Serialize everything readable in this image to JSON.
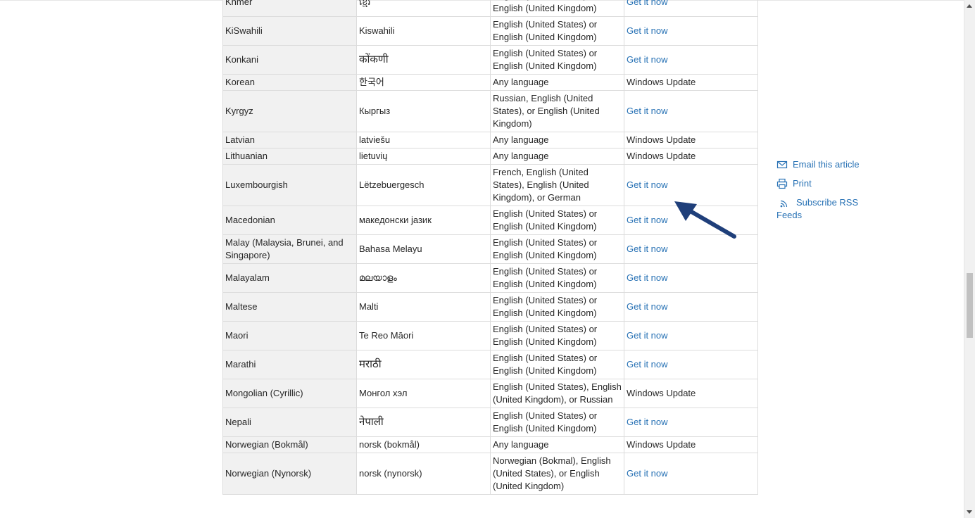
{
  "rows": [
    {
      "language": "Khmer",
      "native": "ខ្មែរ",
      "base": "English (United States) or English (United Kingdom)",
      "get": "Get it now",
      "link": true,
      "large": false
    },
    {
      "language": "KiSwahili",
      "native": "Kiswahili",
      "base": "English (United States) or English (United Kingdom)",
      "get": "Get it now",
      "link": true,
      "large": false
    },
    {
      "language": "Konkani",
      "native": "कोंकणी",
      "base": "English (United States) or English (United Kingdom)",
      "get": "Get it now",
      "link": true,
      "large": true
    },
    {
      "language": "Korean",
      "native": "한국어",
      "base": "Any language",
      "get": "Windows Update",
      "link": false,
      "large": false
    },
    {
      "language": "Kyrgyz",
      "native": "Кыргыз",
      "base": "Russian, English (United States), or English (United Kingdom)",
      "get": "Get it now",
      "link": true,
      "large": false
    },
    {
      "language": "Latvian",
      "native": "latviešu",
      "base": "Any language",
      "get": "Windows Update",
      "link": false,
      "large": false
    },
    {
      "language": "Lithuanian",
      "native": "lietuvių",
      "base": "Any language",
      "get": "Windows Update",
      "link": false,
      "large": false
    },
    {
      "language": "Luxembourgish",
      "native": "Lëtzebuergesch",
      "base": "French, English (United States), English (United Kingdom), or German",
      "get": "Get it now",
      "link": true,
      "large": false
    },
    {
      "language": "Macedonian",
      "native": "македонски јазик",
      "base": "English (United States) or English (United Kingdom)",
      "get": "Get it now",
      "link": true,
      "large": false
    },
    {
      "language": "Malay (Malaysia, Brunei, and Singapore)",
      "native": "Bahasa Melayu",
      "base": "English (United States) or English (United Kingdom)",
      "get": "Get it now",
      "link": true,
      "large": false
    },
    {
      "language": "Malayalam",
      "native": "മലയാളം",
      "base": "English (United States) or English (United Kingdom)",
      "get": "Get it now",
      "link": true,
      "large": false
    },
    {
      "language": "Maltese",
      "native": "Malti",
      "base": "English (United States) or English (United Kingdom)",
      "get": "Get it now",
      "link": true,
      "large": false
    },
    {
      "language": "Maori",
      "native": "Te Reo Māori",
      "base": "English (United States) or English (United Kingdom)",
      "get": "Get it now",
      "link": true,
      "large": false
    },
    {
      "language": "Marathi",
      "native": "मराठी",
      "base": "English (United States) or English (United Kingdom)",
      "get": "Get it now",
      "link": true,
      "large": true
    },
    {
      "language": "Mongolian (Cyrillic)",
      "native": "Монгол хэл",
      "base": "English (United States), English (United Kingdom), or Russian",
      "get": "Windows Update",
      "link": false,
      "large": false
    },
    {
      "language": "Nepali",
      "native": "नेपाली",
      "base": "English (United States) or English (United Kingdom)",
      "get": "Get it now",
      "link": true,
      "large": true
    },
    {
      "language": "Norwegian (Bokmål)",
      "native": "norsk (bokmål)",
      "base": "Any language",
      "get": "Windows Update",
      "link": false,
      "large": false
    },
    {
      "language": "Norwegian (Nynorsk)",
      "native": "norsk (nynorsk)",
      "base": "Norwegian (Bokmal), English (United States), or English (United Kingdom)",
      "get": "Get it now",
      "link": true,
      "large": false
    }
  ],
  "sidebar": {
    "email": "Email this article",
    "print": "Print",
    "rss": "Subscribe RSS",
    "rss_line2": "Feeds"
  },
  "icons": {
    "email": "envelope-icon",
    "print": "printer-icon",
    "rss": "rss-icon",
    "arrow": "arrow-annotation-icon"
  },
  "colors": {
    "link": "#2872b5",
    "arrow": "#1f3f7a",
    "first_column_bg": "#f1f1f1"
  }
}
